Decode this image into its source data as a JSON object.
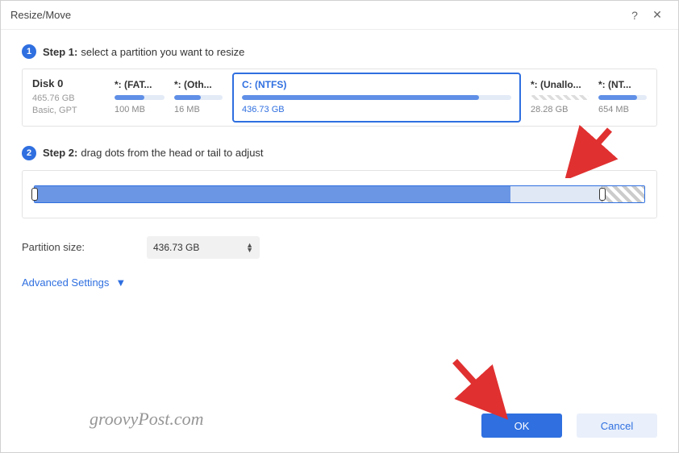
{
  "window": {
    "title": "Resize/Move"
  },
  "step1": {
    "label": "Step 1:",
    "text": "select a partition you want to resize"
  },
  "disk": {
    "name": "Disk 0",
    "size": "465.76 GB",
    "type": "Basic, GPT"
  },
  "partitions": [
    {
      "label": "*: (FAT...",
      "size": "100 MB",
      "fill": 60
    },
    {
      "label": "*: (Oth...",
      "size": "16 MB",
      "fill": 55
    },
    {
      "label": "C: (NTFS)",
      "size": "436.73 GB",
      "fill": 88,
      "selected": true
    },
    {
      "label": "*: (Unallo...",
      "size": "28.28 GB",
      "unalloc": true
    },
    {
      "label": "*: (NT...",
      "size": "654 MB",
      "fill": 80
    }
  ],
  "step2": {
    "label": "Step 2:",
    "text": "drag dots from the head or tail to adjust"
  },
  "slider": {
    "usedPct": 78,
    "freePct": 15,
    "unallocPct": 7
  },
  "sizeField": {
    "label": "Partition size:",
    "value": "436.73 GB"
  },
  "advanced": "Advanced Settings",
  "buttons": {
    "ok": "OK",
    "cancel": "Cancel"
  },
  "watermark": "groovyPost.com"
}
